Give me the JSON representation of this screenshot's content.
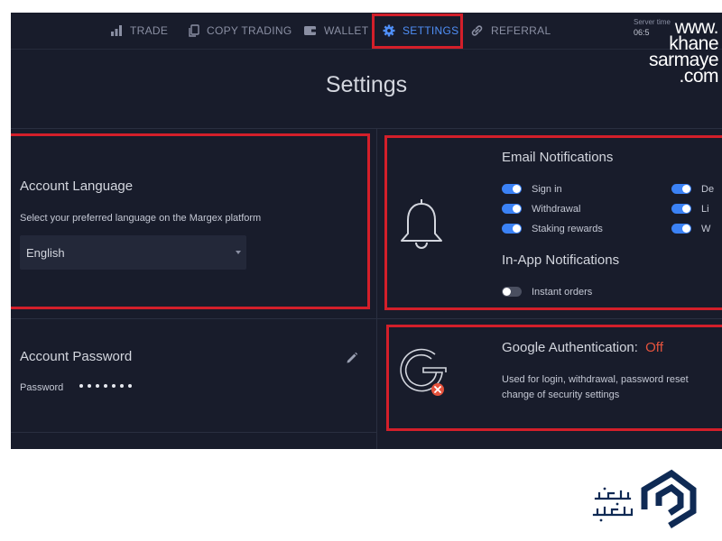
{
  "nav": {
    "items": [
      {
        "label": "TRADE",
        "icon": "bar-chart-icon"
      },
      {
        "label": "COPY TRADING",
        "icon": "copy-icon"
      },
      {
        "label": "WALLET",
        "icon": "wallet-icon"
      },
      {
        "label": "SETTINGS",
        "icon": "gear-icon",
        "active": true
      },
      {
        "label": "REFERRAL",
        "icon": "link-icon"
      }
    ],
    "server_time_label": "Server time",
    "server_time_value": "06:5"
  },
  "watermark": {
    "line1": "www.",
    "line2": "khane",
    "line3": "sarmaye",
    "line4": ".com"
  },
  "page": {
    "title": "Settings"
  },
  "account_language": {
    "title": "Account Language",
    "description": "Select your preferred language on the Margex platform",
    "selected": "English"
  },
  "email_notifications": {
    "title": "Email Notifications",
    "left": [
      {
        "label": "Sign in",
        "on": true
      },
      {
        "label": "Withdrawal",
        "on": true
      },
      {
        "label": "Staking rewards",
        "on": true
      }
    ],
    "right": [
      {
        "label": "De",
        "on": true
      },
      {
        "label": "Li",
        "on": true
      },
      {
        "label": "W",
        "on": true
      }
    ]
  },
  "inapp_notifications": {
    "title": "In-App Notifications",
    "items": [
      {
        "label": "Instant orders",
        "on": false
      }
    ]
  },
  "account_password": {
    "title": "Account Password",
    "label": "Password",
    "masked_value": "•••••••"
  },
  "google_auth": {
    "title": "Google Authentication:",
    "status": "Off",
    "description_line1": "Used for login, withdrawal, password reset",
    "description_line2": "change of security settings"
  },
  "colors": {
    "background": "#181c2b",
    "accent": "#4f8ff7",
    "highlight": "#d31f2a",
    "status_off": "#e5533d"
  }
}
